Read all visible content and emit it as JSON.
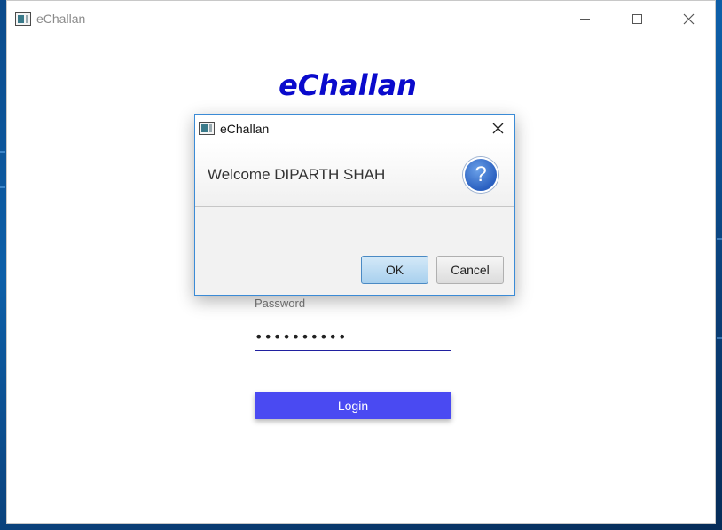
{
  "main_window": {
    "title": "eChallan",
    "heading": "eChallan",
    "password_label": "Password",
    "password_value": "••••••••••",
    "login_label": "Login"
  },
  "dialog": {
    "title": "eChallan",
    "message": "Welcome DIPARTH SHAH",
    "question_mark": "?",
    "ok_label": "OK",
    "cancel_label": "Cancel"
  },
  "icons": {
    "app": "app-window-icon",
    "minimize": "minimize-icon",
    "maximize": "maximize-icon",
    "close": "close-icon",
    "question": "question-icon"
  },
  "colors": {
    "heading": "#0a0acc",
    "login_button": "#4a4af2",
    "dialog_border": "#3b8bd6",
    "question_icon": "#2a60c0"
  }
}
